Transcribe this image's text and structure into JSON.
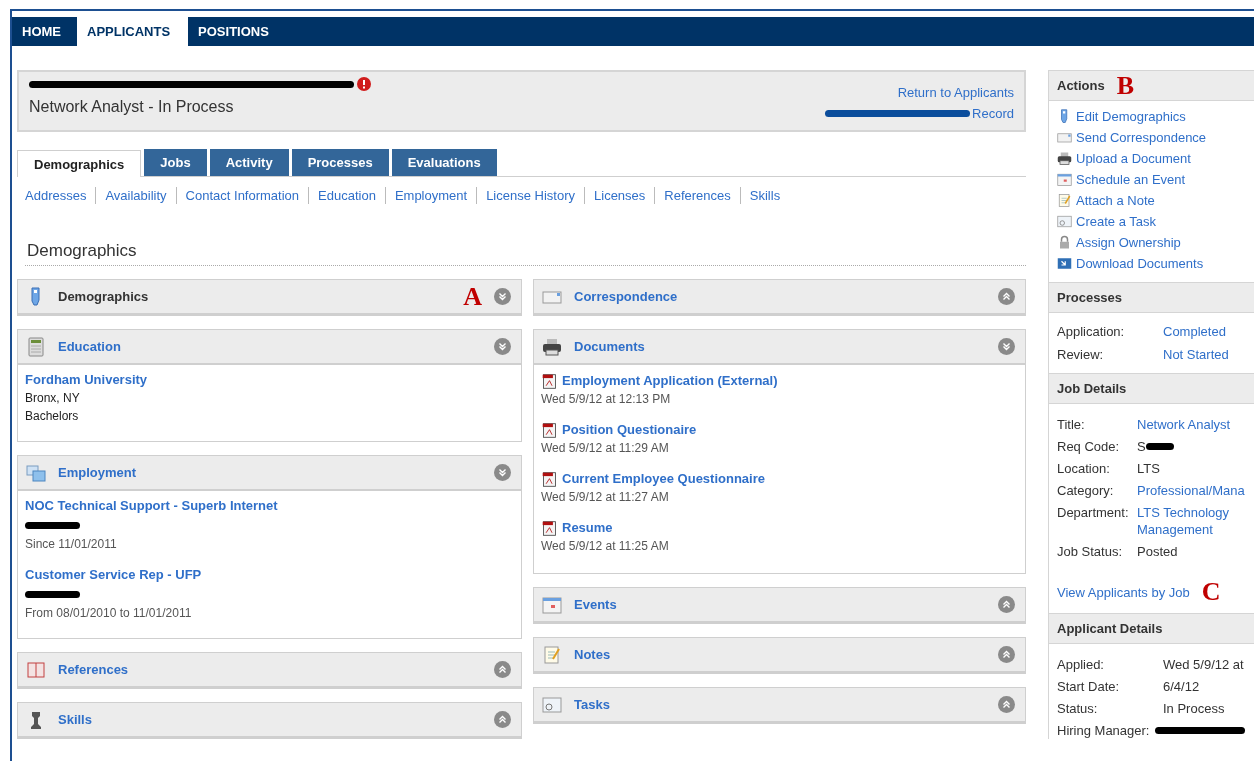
{
  "nav": [
    {
      "label": "HOME",
      "selected": false
    },
    {
      "label": "APPLICANTS",
      "selected": true
    },
    {
      "label": "POSITIONS",
      "selected": false
    }
  ],
  "header": {
    "name_redacted": true,
    "alert": true,
    "subtitle": "Network Analyst - In Process",
    "links": [
      {
        "label": "Return to Applicants",
        "redacted_prefix": false
      },
      {
        "label": "Record",
        "redacted_prefix": true
      }
    ]
  },
  "tabs": [
    {
      "label": "Demographics",
      "selected": true
    },
    {
      "label": "Jobs",
      "selected": false
    },
    {
      "label": "Activity",
      "selected": false
    },
    {
      "label": "Processes",
      "selected": false
    },
    {
      "label": "Evaluations",
      "selected": false
    }
  ],
  "subnav": [
    "Addresses",
    "Availability",
    "Contact Information",
    "Education",
    "Employment",
    "License History",
    "Licenses",
    "References",
    "Skills"
  ],
  "section_title": "Demographics",
  "left_panels": [
    {
      "title": "Demographics",
      "current": true,
      "expanded": true,
      "annotation": "A"
    },
    {
      "title": "Education",
      "current": false,
      "expanded": true,
      "entries": [
        {
          "title": "Fordham University",
          "redacted": false,
          "lines": [
            "Bronx, NY",
            "Bachelors"
          ]
        }
      ]
    },
    {
      "title": "Employment",
      "current": false,
      "expanded": true,
      "entries": [
        {
          "title": "NOC Technical Support - Superb Internet",
          "redacted": true,
          "lines": [
            "Since 11/01/2011"
          ]
        },
        {
          "title": "Customer Service Rep - UFP",
          "redacted": true,
          "lines": [
            "From 08/01/2010 to 11/01/2011"
          ]
        }
      ]
    },
    {
      "title": "References",
      "current": false,
      "expanded": false
    },
    {
      "title": "Skills",
      "current": false,
      "expanded": false
    }
  ],
  "right_panels": [
    {
      "title": "Correspondence",
      "current": false,
      "expanded": false
    },
    {
      "title": "Documents",
      "current": false,
      "expanded": true,
      "documents": [
        {
          "title": "Employment Application (External)",
          "date": "Wed 5/9/12 at 12:13 PM"
        },
        {
          "title": "Position Questionaire",
          "date": "Wed 5/9/12 at 11:29 AM"
        },
        {
          "title": "Current Employee Questionnaire",
          "date": "Wed 5/9/12 at 11:27 AM"
        },
        {
          "title": "Resume",
          "date": "Wed 5/9/12 at 11:25 AM"
        }
      ]
    },
    {
      "title": "Events",
      "current": false,
      "expanded": false
    },
    {
      "title": "Notes",
      "current": false,
      "expanded": false
    },
    {
      "title": "Tasks",
      "current": false,
      "expanded": false
    }
  ],
  "sidebar": {
    "actions": {
      "title": "Actions",
      "annotation": "B",
      "items": [
        "Edit Demographics",
        "Send Correspondence",
        "Upload a Document",
        "Schedule an Event",
        "Attach a Note",
        "Create a Task",
        "Assign Ownership",
        "Download Documents"
      ]
    },
    "processes": {
      "title": "Processes",
      "rows": [
        {
          "label": "Application:",
          "value": "Completed",
          "link": true
        },
        {
          "label": "Review:",
          "value": "Not Started",
          "link": true
        }
      ]
    },
    "job_details": {
      "title": "Job Details",
      "rows": [
        {
          "label": "Title:",
          "value": "Network Analyst",
          "link": true,
          "redacted": false
        },
        {
          "label": "Req Code:",
          "value": "S",
          "link": false,
          "redacted": true
        },
        {
          "label": "Location:",
          "value": "LTS",
          "link": false,
          "redacted": false
        },
        {
          "label": "Category:",
          "value": "Professional/Mana",
          "link": true,
          "redacted": false
        },
        {
          "label": "Department:",
          "value": "LTS Technology Management",
          "link": true,
          "redacted": false
        },
        {
          "label": "Job Status:",
          "value": "Posted",
          "link": false,
          "redacted": false
        }
      ],
      "link": "View Applicants by Job",
      "annotation": "C"
    },
    "applicant_details": {
      "title": "Applicant Details",
      "rows": [
        {
          "label": "Applied:",
          "value": "Wed 5/9/12 at",
          "redacted": false
        },
        {
          "label": "Start Date:",
          "value": "6/4/12",
          "redacted": false
        },
        {
          "label": "Status:",
          "value": "In Process",
          "redacted": false
        },
        {
          "label": "Hiring Manager:",
          "redacted": true
        }
      ]
    }
  }
}
